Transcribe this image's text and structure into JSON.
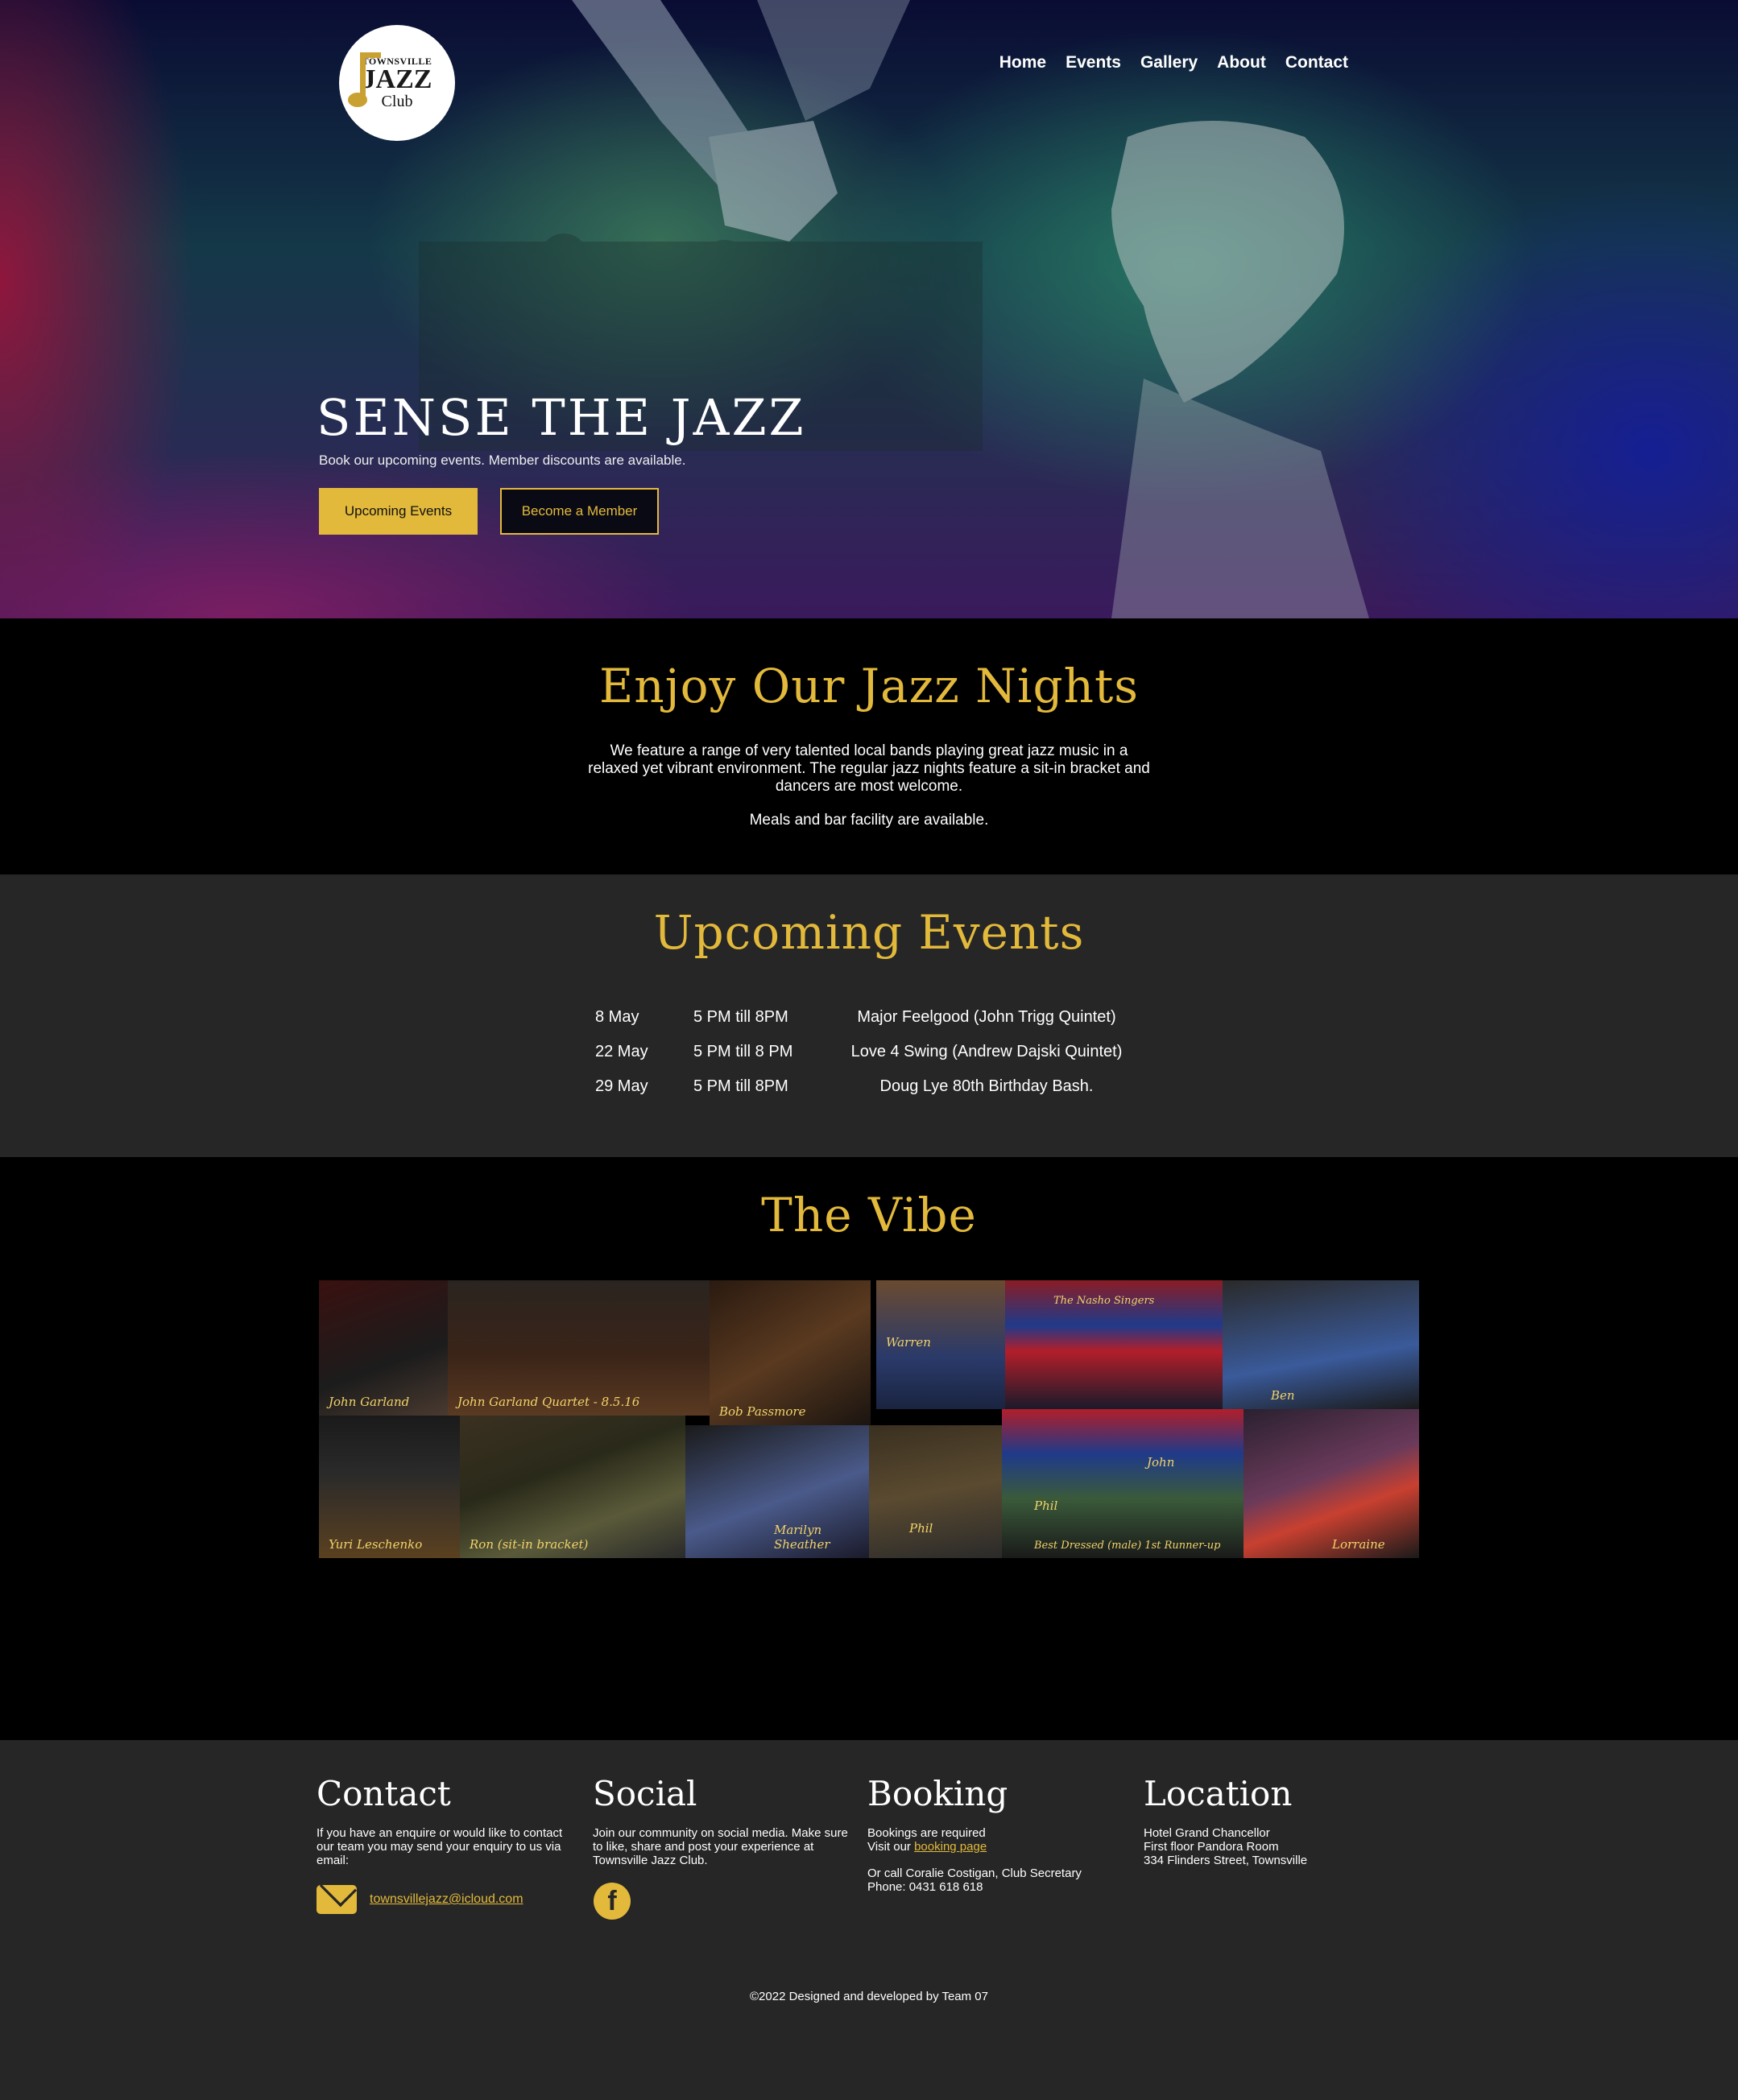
{
  "logo": {
    "line1": "TOWNSVILLE",
    "line2": "JAZZ",
    "line3": "Club"
  },
  "nav": [
    "Home",
    "Events",
    "Gallery",
    "About",
    "Contact"
  ],
  "hero": {
    "title": "SENSE THE JAZZ",
    "subtitle": "Book our upcoming events. Member discounts are available.",
    "primary_button": "Upcoming Events",
    "secondary_button": "Become a Member"
  },
  "intro": {
    "title": "Enjoy Our Jazz Nights",
    "text": "We feature a range of very talented local bands playing great jazz music in a relaxed yet vibrant environment. The regular jazz nights feature a sit-in bracket and dancers are most welcome.",
    "text2": "Meals and bar facility are available."
  },
  "events": {
    "title": "Upcoming Events",
    "items": [
      {
        "date": "8 May",
        "time": "5 PM till 8PM",
        "name": "Major Feelgood  (John Trigg Quintet)"
      },
      {
        "date": "22  May",
        "time": "5 PM till 8 PM",
        "name": "Love 4 Swing (Andrew Dajski Quintet)"
      },
      {
        "date": "29 May",
        "time": "5 PM till 8PM",
        "name": "Doug Lye 80th Birthday Bash."
      }
    ]
  },
  "vibe": {
    "title": "The Vibe",
    "captions": [
      "John Garland",
      "John Garland Quartet - 8.5.16",
      "Bob Passmore",
      "Warren",
      "The Nasho Singers",
      "Ben",
      "Yuri Leschenko",
      "Ron (sit-in bracket)",
      "Marilyn Sheather",
      "Phil",
      "Phil",
      "John",
      "Best Dressed (male) 1st Runner-up",
      "Lorraine"
    ]
  },
  "footer": {
    "contact": {
      "title": "Contact",
      "text": "If you have an enquire or would like to contact our team you may send your enquiry to us via email:",
      "email": "townsvillejazz@icloud.com"
    },
    "social": {
      "title": "Social",
      "text": "Join our community on social media. Make sure to like, share and post your experience at Townsville Jazz Club."
    },
    "booking": {
      "title": "Booking",
      "line1": "Bookings are required",
      "line2_prefix": "Visit our ",
      "line2_link": "booking page",
      "line3": "Or call Coralie Costigan, Club Secretary",
      "line4": "Phone: 0431 618 618"
    },
    "location": {
      "title": "Location",
      "line1": "Hotel Grand Chancellor",
      "line2": "First floor Pandora Room",
      "line3": "334 Flinders Street, Townsville"
    },
    "copyright": "©2022 Designed and developed by Team 07"
  },
  "colors": {
    "gold": "#e2b93b",
    "dark": "#262626",
    "black": "#000000"
  },
  "icons": {
    "email": "envelope-icon",
    "facebook": "facebook-icon"
  }
}
